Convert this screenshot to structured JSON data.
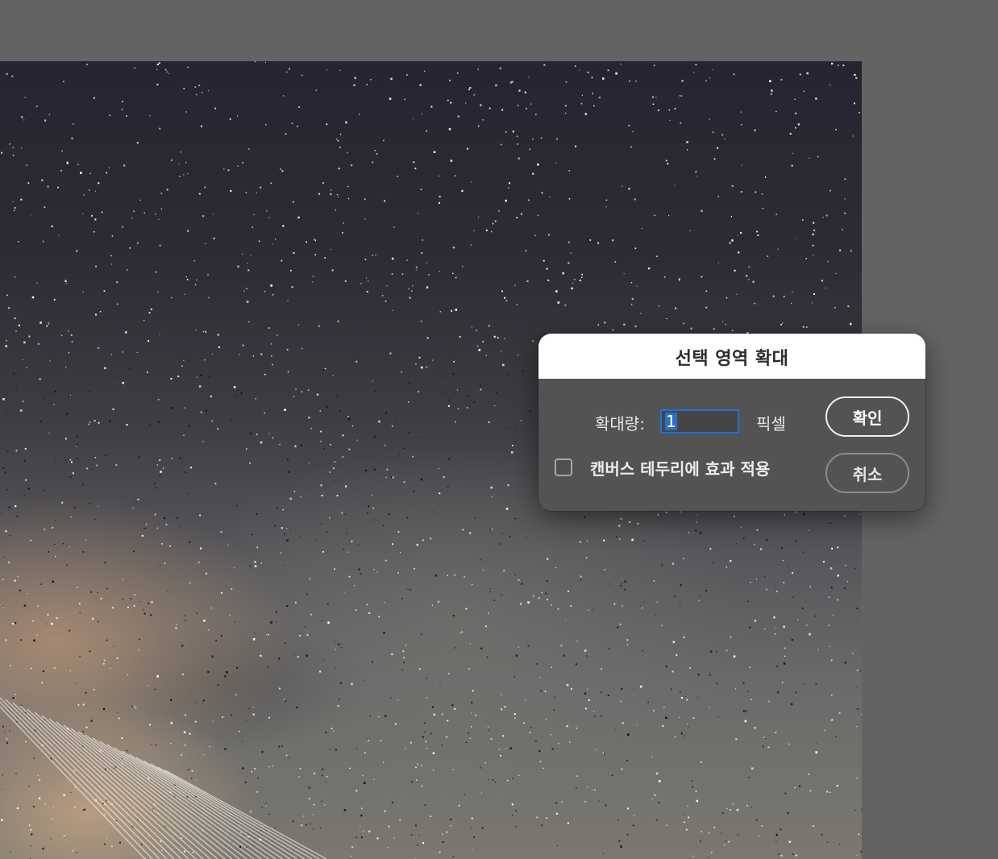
{
  "dialog": {
    "title": "선택 영역 확대",
    "amount_label": "확대량:",
    "amount_value": "1",
    "unit_label": "픽셀",
    "checkbox_label": "캔버스 테두리에 효과 적용",
    "checkbox_checked": false,
    "ok_label": "확인",
    "cancel_label": "취소",
    "accent_color": "#1d74d8"
  },
  "canvas": {
    "image_subject": "starry-night-sky-photo",
    "workspace_color": "#636363"
  }
}
